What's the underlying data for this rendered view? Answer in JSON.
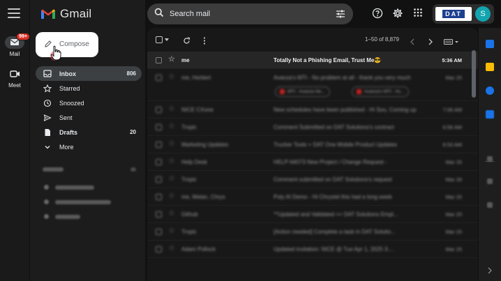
{
  "app": {
    "name": "Gmail"
  },
  "rail": {
    "items": [
      {
        "label": "Mail",
        "badge": "99+"
      },
      {
        "label": "Meet"
      }
    ]
  },
  "compose": {
    "label": "Compose"
  },
  "nav": {
    "items": [
      {
        "label": "Inbox",
        "count": "806",
        "icon": "inbox-icon"
      },
      {
        "label": "Starred",
        "count": "",
        "icon": "star-icon"
      },
      {
        "label": "Snoozed",
        "count": "",
        "icon": "clock-icon"
      },
      {
        "label": "Sent",
        "count": "",
        "icon": "send-icon"
      },
      {
        "label": "Drafts",
        "count": "20",
        "icon": "draft-icon"
      },
      {
        "label": "More",
        "count": "",
        "icon": "chevron-down-icon"
      }
    ]
  },
  "search": {
    "placeholder": "Search mail"
  },
  "account": {
    "org_logo": "DAT",
    "avatar_letter": "S"
  },
  "list": {
    "pager": "1–50 of 8,879",
    "rows": [
      {
        "sender": "me",
        "subject": "Totally Not a Phishing Email, Trust Me😎",
        "time": "5:36 AM",
        "unread": true,
        "blurred": false
      },
      {
        "sender": "me, Herbert",
        "subject": "Avanza's MTI - No problem at all - thank you very much",
        "time": "Mar 25",
        "unread": false,
        "blurred": true,
        "attachments": [
          "MTI - Avanza Ne...",
          "Avanza's MTI - Av..."
        ]
      },
      {
        "sender": "NICE CXone",
        "subject": "New schedules have been published - Hi Sou, Coming up",
        "time": "7:06 AM",
        "unread": false,
        "blurred": true
      },
      {
        "sender": "Tropic",
        "subject": "Comment Submitted on DAT Solutions's contract",
        "time": "6:56 AM",
        "unread": false,
        "blurred": true
      },
      {
        "sender": "Marketing Updates",
        "subject": "Trucker Tools + DAT One Mobile Product Updates",
        "time": "6:53 AM",
        "unread": false,
        "blurred": true
      },
      {
        "sender": "Help Desk",
        "subject": "HELP-64073 New Project / Change Request -",
        "time": "Mar 26",
        "unread": false,
        "blurred": true
      },
      {
        "sender": "Tropic",
        "subject": "Comment submitted on DAT Solutions's request",
        "time": "Mar 26",
        "unread": false,
        "blurred": true
      },
      {
        "sender": "me, Melan, Chrys",
        "subject": "Poly AI Demo - Hi Chrystel this had a long week",
        "time": "Mar 25",
        "unread": false,
        "blurred": true
      },
      {
        "sender": "Github",
        "subject": "**Updated and Validated == DAT Solutions Empl...",
        "time": "Mar 25",
        "unread": false,
        "blurred": true
      },
      {
        "sender": "Tropic",
        "subject": "[Action needed] Complete a task in DAT Solutio...",
        "time": "Mar 25",
        "unread": false,
        "blurred": true
      },
      {
        "sender": "Adam Pollock",
        "subject": "Updated invitation: NICE @ Tue Apr 1, 2025 3:...",
        "time": "Mar 25",
        "unread": false,
        "blurred": true
      }
    ]
  },
  "colors": {
    "accent_red": "#d93025",
    "avatar_teal": "#12a4af",
    "unread_bg": "#262626"
  }
}
